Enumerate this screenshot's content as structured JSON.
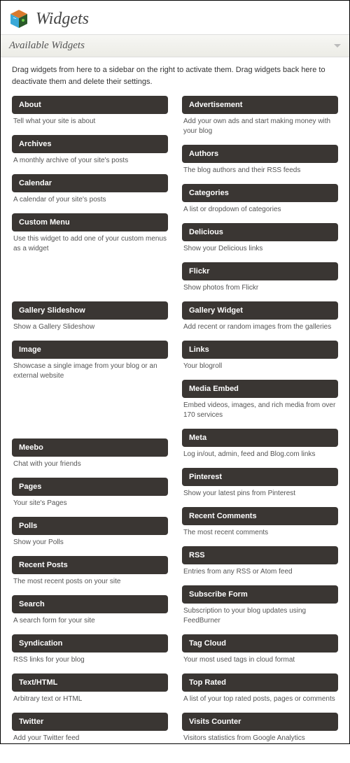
{
  "header": {
    "title": "Widgets"
  },
  "panel": {
    "title": "Available Widgets"
  },
  "instructions": "Drag widgets from here to a sidebar on the right to activate them. Drag widgets back here to deactivate them and delete their settings.",
  "left": [
    {
      "title": "About",
      "desc": "Tell what your site is about"
    },
    {
      "title": "Archives",
      "desc": "A monthly archive of your site's posts"
    },
    {
      "title": "Calendar",
      "desc": "A calendar of your site's posts"
    },
    {
      "title": "Custom Menu",
      "desc": "Use this widget to add one of your custom menus as a widget"
    },
    {
      "title": "Gallery Slideshow",
      "desc": "Show a Gallery Slideshow"
    },
    {
      "title": "Image",
      "desc": "Showcase a single image from your blog or an external website"
    },
    {
      "title": "Meebo",
      "desc": "Chat with your friends"
    },
    {
      "title": "Pages",
      "desc": "Your site's Pages"
    },
    {
      "title": "Polls",
      "desc": "Show your Polls"
    },
    {
      "title": "Recent Posts",
      "desc": "The most recent posts on your site"
    },
    {
      "title": "Search",
      "desc": "A search form for your site"
    },
    {
      "title": "Syndication",
      "desc": "RSS links for your blog"
    },
    {
      "title": "Text/HTML",
      "desc": "Arbitrary text or HTML"
    },
    {
      "title": "Twitter",
      "desc": "Add your Twitter feed"
    }
  ],
  "right": [
    {
      "title": "Advertisement",
      "desc": "Add your own ads and start making money with your blog"
    },
    {
      "title": "Authors",
      "desc": "The blog authors and their RSS feeds"
    },
    {
      "title": "Categories",
      "desc": "A list or dropdown of categories"
    },
    {
      "title": "Delicious",
      "desc": "Show your Delicious links"
    },
    {
      "title": "Flickr",
      "desc": "Show photos from Flickr"
    },
    {
      "title": "Gallery Widget",
      "desc": "Add recent or random images from the galleries"
    },
    {
      "title": "Links",
      "desc": "Your blogroll"
    },
    {
      "title": "Media Embed",
      "desc": "Embed videos, images, and rich media from over 170 services"
    },
    {
      "title": "Meta",
      "desc": "Log in/out, admin, feed and Blog.com links"
    },
    {
      "title": "Pinterest",
      "desc": "Show your latest pins from Pinterest"
    },
    {
      "title": "Recent Comments",
      "desc": "The most recent comments"
    },
    {
      "title": "RSS",
      "desc": "Entries from any RSS or Atom feed"
    },
    {
      "title": "Subscribe Form",
      "desc": "Subscription to your blog updates using FeedBurner"
    },
    {
      "title": "Tag Cloud",
      "desc": "Your most used tags in cloud format"
    },
    {
      "title": "Top Rated",
      "desc": "A list of your top rated posts, pages or comments"
    },
    {
      "title": "Visits Counter",
      "desc": "Visitors statistics from Google Analytics"
    }
  ]
}
